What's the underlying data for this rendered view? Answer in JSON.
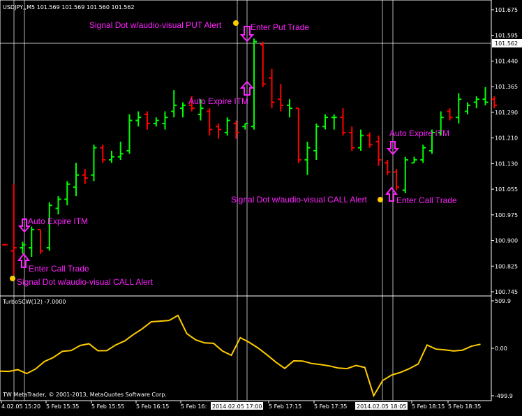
{
  "window": {
    "symbol_line": "USDJPY,,M5  101.569 101.569 101.560 101.562",
    "copyright": "TW MetaTrader, © 2001-2013, MetaQuotes Software Corp."
  },
  "price_axis": {
    "labels": [
      "101.675",
      "101.595",
      "101.440",
      "101.365",
      "101.290",
      "101.210",
      "101.130",
      "101.055",
      "100.975",
      "100.900",
      "100.825",
      "100.745"
    ],
    "current_price": "101.562"
  },
  "indicator": {
    "title": "TurboSCW(12) -7.0000",
    "axis_labels": [
      "509.9",
      "0.00",
      "-499.9"
    ]
  },
  "time_axis": {
    "labels": [
      "4.02.05 15:20",
      "5 Feb 15:35",
      "5 Feb 15:55",
      "5 Feb 16:15",
      "5 Feb 16:",
      "5 Feb 17:15",
      "5 Feb 17:35",
      "5 Feb 18:15",
      "5 Feb 18:35"
    ],
    "highlight_labels": [
      "2014.02.05 17:00",
      "2014.02.05 18:05"
    ]
  },
  "annotations": {
    "put_alert": "Signal Dot w/audio-visual PUT Alert",
    "enter_put": "Enter Put Trade",
    "auto_itm_mid": "Auto Expire ITM",
    "auto_itm_left": "Auto Expire ITM",
    "enter_call_left": "Enter Call Trade",
    "call_alert_left": "Signal Dot w/audio-visual CALL Alert",
    "auto_itm_right": "Auto Expire ITM",
    "call_alert_right": "Signal Dot w/audio-visual CALL Alert",
    "enter_call_right": "Enter Call Trade"
  },
  "colors": {
    "bull": "#00ff00",
    "bear": "#ff0000",
    "annotation": "#ff22ff",
    "signal_dot": "#ffcc00",
    "indicator_line": "#ffcc00"
  },
  "chart_data": {
    "type": "bar",
    "bars": [
      {
        "o": 100.9,
        "h": 100.9,
        "l": 100.9,
        "c": 100.9,
        "up": false
      },
      {
        "o": 100.88,
        "h": 101.1,
        "l": 100.8,
        "c": 100.89,
        "up": false
      },
      {
        "o": 100.89,
        "h": 100.91,
        "l": 100.87,
        "c": 100.9,
        "up": true
      },
      {
        "o": 100.89,
        "h": 100.96,
        "l": 100.86,
        "c": 100.95,
        "up": true
      },
      {
        "o": 100.95,
        "h": 100.95,
        "l": 100.87,
        "c": 100.88,
        "up": false
      },
      {
        "o": 100.89,
        "h": 101.04,
        "l": 100.88,
        "c": 101.03,
        "up": true
      },
      {
        "o": 101.02,
        "h": 101.06,
        "l": 101.0,
        "c": 101.05,
        "up": true
      },
      {
        "o": 101.05,
        "h": 101.11,
        "l": 101.03,
        "c": 101.1,
        "up": true
      },
      {
        "o": 101.09,
        "h": 101.17,
        "l": 101.06,
        "c": 101.13,
        "up": true
      },
      {
        "o": 101.13,
        "h": 101.15,
        "l": 101.1,
        "c": 101.12,
        "up": false
      },
      {
        "o": 101.13,
        "h": 101.23,
        "l": 101.11,
        "c": 101.22,
        "up": true
      },
      {
        "o": 101.22,
        "h": 101.23,
        "l": 101.17,
        "c": 101.18,
        "up": false
      },
      {
        "o": 101.18,
        "h": 101.21,
        "l": 101.17,
        "c": 101.19,
        "up": true
      },
      {
        "o": 101.19,
        "h": 101.24,
        "l": 101.18,
        "c": 101.2,
        "up": true
      },
      {
        "o": 101.21,
        "h": 101.33,
        "l": 101.2,
        "c": 101.31,
        "up": true
      },
      {
        "o": 101.31,
        "h": 101.34,
        "l": 101.29,
        "c": 101.32,
        "up": true
      },
      {
        "o": 101.33,
        "h": 101.34,
        "l": 101.28,
        "c": 101.3,
        "up": false
      },
      {
        "o": 101.3,
        "h": 101.32,
        "l": 101.29,
        "c": 101.31,
        "up": true
      },
      {
        "o": 101.3,
        "h": 101.34,
        "l": 101.28,
        "c": 101.32,
        "up": true
      },
      {
        "o": 101.34,
        "h": 101.41,
        "l": 101.32,
        "c": 101.36,
        "up": true
      },
      {
        "o": 101.35,
        "h": 101.37,
        "l": 101.32,
        "c": 101.36,
        "up": true
      },
      {
        "o": 101.36,
        "h": 101.39,
        "l": 101.34,
        "c": 101.35,
        "up": false
      },
      {
        "o": 101.33,
        "h": 101.38,
        "l": 101.31,
        "c": 101.35,
        "up": true
      },
      {
        "o": 101.34,
        "h": 101.35,
        "l": 101.26,
        "c": 101.28,
        "up": false
      },
      {
        "o": 101.29,
        "h": 101.3,
        "l": 101.25,
        "c": 101.28,
        "up": false
      },
      {
        "o": 101.27,
        "h": 101.32,
        "l": 101.26,
        "c": 101.31,
        "up": true
      },
      {
        "o": 101.3,
        "h": 101.31,
        "l": 101.25,
        "c": 101.27,
        "up": false
      },
      {
        "o": 101.29,
        "h": 101.3,
        "l": 101.28,
        "c": 101.3,
        "up": true
      },
      {
        "o": 101.29,
        "h": 101.58,
        "l": 101.28,
        "c": 101.57,
        "up": true
      },
      {
        "o": 101.56,
        "h": 101.57,
        "l": 101.42,
        "c": 101.43,
        "up": false
      },
      {
        "o": 101.45,
        "h": 101.48,
        "l": 101.35,
        "c": 101.37,
        "up": false
      },
      {
        "o": 101.38,
        "h": 101.43,
        "l": 101.34,
        "c": 101.36,
        "up": false
      },
      {
        "o": 101.36,
        "h": 101.38,
        "l": 101.32,
        "c": 101.35,
        "up": true
      },
      {
        "o": 101.35,
        "h": 101.35,
        "l": 101.17,
        "c": 101.18,
        "up": false
      },
      {
        "o": 101.18,
        "h": 101.24,
        "l": 101.13,
        "c": 101.22,
        "up": true
      },
      {
        "o": 101.21,
        "h": 101.3,
        "l": 101.18,
        "c": 101.29,
        "up": true
      },
      {
        "o": 101.29,
        "h": 101.33,
        "l": 101.28,
        "c": 101.32,
        "up": true
      },
      {
        "o": 101.32,
        "h": 101.33,
        "l": 101.28,
        "c": 101.32,
        "up": true
      },
      {
        "o": 101.32,
        "h": 101.35,
        "l": 101.26,
        "c": 101.27,
        "up": false
      },
      {
        "o": 101.27,
        "h": 101.29,
        "l": 101.21,
        "c": 101.22,
        "up": false
      },
      {
        "o": 101.22,
        "h": 101.28,
        "l": 101.21,
        "c": 101.26,
        "up": true
      },
      {
        "o": 101.26,
        "h": 101.27,
        "l": 101.22,
        "c": 101.23,
        "up": false
      },
      {
        "o": 101.24,
        "h": 101.26,
        "l": 101.16,
        "c": 101.18,
        "up": false
      },
      {
        "o": 101.17,
        "h": 101.18,
        "l": 101.13,
        "c": 101.14,
        "up": false
      },
      {
        "o": 101.14,
        "h": 101.15,
        "l": 101.08,
        "c": 101.09,
        "up": false
      },
      {
        "o": 101.08,
        "h": 101.19,
        "l": 101.07,
        "c": 101.18,
        "up": true
      },
      {
        "o": 101.17,
        "h": 101.19,
        "l": 101.17,
        "c": 101.18,
        "up": true
      },
      {
        "o": 101.18,
        "h": 101.23,
        "l": 101.17,
        "c": 101.22,
        "up": true
      },
      {
        "o": 101.21,
        "h": 101.28,
        "l": 101.2,
        "c": 101.27,
        "up": true
      },
      {
        "o": 101.27,
        "h": 101.34,
        "l": 101.26,
        "c": 101.32,
        "up": true
      },
      {
        "o": 101.34,
        "h": 101.35,
        "l": 101.31,
        "c": 101.32,
        "up": false
      },
      {
        "o": 101.32,
        "h": 101.4,
        "l": 101.3,
        "c": 101.38,
        "up": true
      },
      {
        "o": 101.34,
        "h": 101.37,
        "l": 101.33,
        "c": 101.36,
        "up": true
      },
      {
        "o": 101.37,
        "h": 101.39,
        "l": 101.35,
        "c": 101.38,
        "up": true
      },
      {
        "o": 101.38,
        "h": 101.42,
        "l": 101.36,
        "c": 101.37,
        "up": true
      },
      {
        "o": 101.38,
        "h": 101.39,
        "l": 101.35,
        "c": 101.36,
        "up": false
      }
    ],
    "price_range": [
      100.745,
      101.675
    ],
    "indicator_values": [
      -238,
      -241,
      -222,
      -264,
      -215,
      -135,
      -92,
      -28,
      -19,
      35,
      53,
      -21,
      -20,
      41,
      82,
      152,
      214,
      287,
      294,
      301,
      355,
      160,
      94,
      62,
      58,
      -24,
      -69,
      118,
      69,
      8,
      -64,
      -142,
      -209,
      -129,
      -130,
      -156,
      -168,
      -182,
      -205,
      -211,
      -178,
      -199,
      -499,
      -338,
      -280,
      -251,
      -212,
      -161,
      40,
      -4,
      -12,
      -24,
      -14,
      28,
      48
    ],
    "indicator_range": [
      -499.9,
      509.9
    ]
  }
}
